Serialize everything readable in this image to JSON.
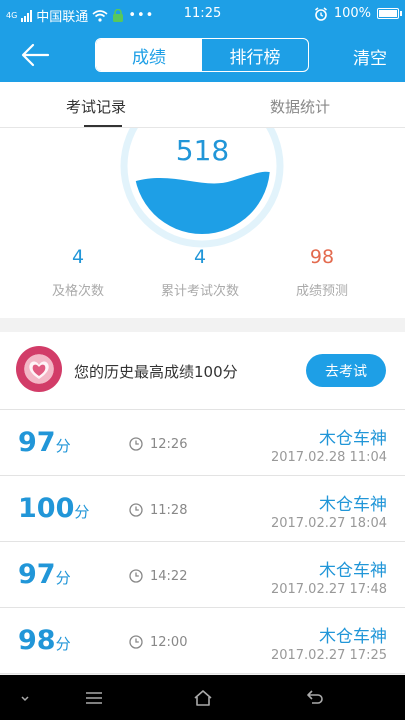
{
  "status_bar": {
    "carrier": "中国联通",
    "network": "4G",
    "time": "11:25",
    "battery": "100%"
  },
  "nav": {
    "segments": [
      {
        "label": "成绩",
        "active": true
      },
      {
        "label": "排行榜",
        "active": false
      }
    ],
    "clear_label": "清空"
  },
  "tabs": [
    {
      "label": "考试记录",
      "active": true
    },
    {
      "label": "数据统计",
      "active": false
    }
  ],
  "gauge": {
    "score": "518",
    "fill_fraction": 0.45
  },
  "stats": [
    {
      "value": "4",
      "label": "及格次数"
    },
    {
      "value": "4",
      "label": "累计考试次数"
    },
    {
      "value": "98",
      "label": "成绩预测"
    }
  ],
  "best": {
    "text": "您的历史最高成绩100分",
    "button_label": "去考试"
  },
  "records": [
    {
      "score": "97",
      "unit": "分",
      "duration": "12:26",
      "name": "木仓车神",
      "date": "2017.02.28  11:04"
    },
    {
      "score": "100",
      "unit": "分",
      "duration": "11:28",
      "name": "木仓车神",
      "date": "2017.02.27  18:04"
    },
    {
      "score": "97",
      "unit": "分",
      "duration": "14:22",
      "name": "木仓车神",
      "date": "2017.02.27  17:48"
    },
    {
      "score": "98",
      "unit": "分",
      "duration": "12:00",
      "name": "木仓车神",
      "date": "2017.02.27  17:25"
    }
  ],
  "colors": {
    "primary": "#1e9fe6",
    "score_blue": "#2196d8",
    "prediction": "#e36a4e"
  }
}
